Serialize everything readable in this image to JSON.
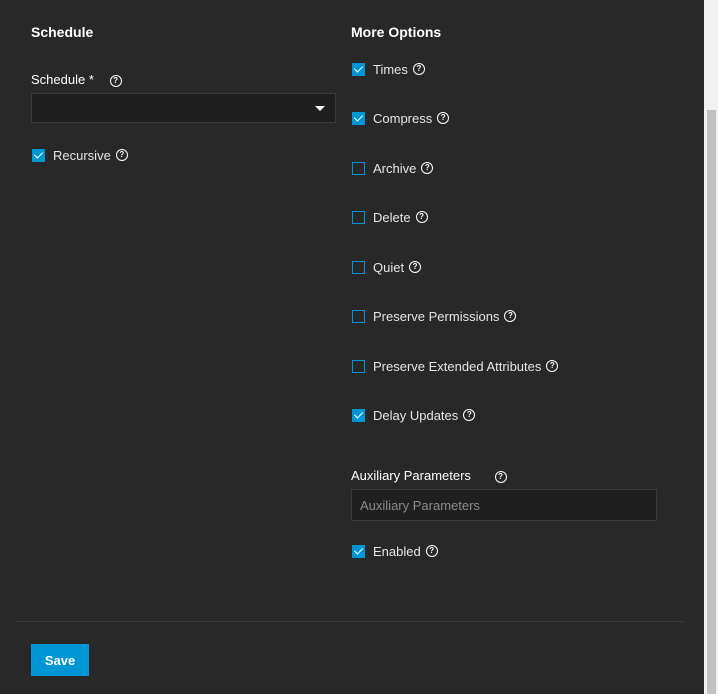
{
  "schedule_section": {
    "title": "Schedule",
    "schedule_label": "Schedule *",
    "schedule_value": "",
    "recursive": {
      "label": "Recursive",
      "checked": true
    }
  },
  "options_section": {
    "title": "More Options",
    "options": [
      {
        "label": "Times",
        "checked": true
      },
      {
        "label": "Compress",
        "checked": true
      },
      {
        "label": "Archive",
        "checked": false
      },
      {
        "label": "Delete",
        "checked": false
      },
      {
        "label": "Quiet",
        "checked": false
      },
      {
        "label": "Preserve Permissions",
        "checked": false
      },
      {
        "label": "Preserve Extended Attributes",
        "checked": false
      },
      {
        "label": "Delay Updates",
        "checked": true
      }
    ],
    "aux_label": "Auxiliary Parameters",
    "aux_placeholder": "Auxiliary Parameters",
    "aux_value": "",
    "enabled": {
      "label": "Enabled",
      "checked": true
    }
  },
  "footer": {
    "save_label": "Save"
  },
  "help_glyph": "?",
  "colors": {
    "accent": "#0095d5",
    "background": "#282828",
    "field": "#1f1f1f"
  }
}
